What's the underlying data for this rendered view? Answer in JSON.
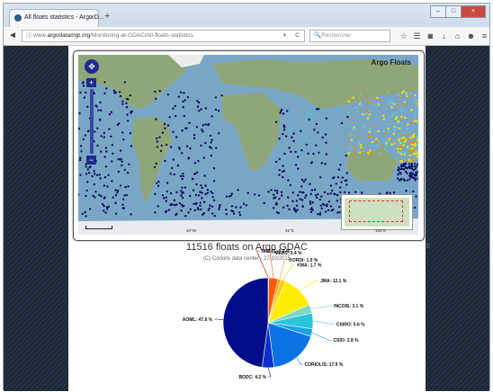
{
  "browser": {
    "tab_title": "All floats statistics - Argo D...",
    "tab_close": "×",
    "new_tab": "+",
    "window_minimize": "–",
    "window_maximize": "□",
    "window_close": "×",
    "back": "◄",
    "lock": "ⓘ",
    "url_prefix": "www.",
    "url_host": "argodatamgt.org",
    "url_path": "/Monitoring-at-GDAC/All-floats-statistics",
    "url_dropdown": "▾",
    "reload": "C",
    "search_placeholder": "Rechercher",
    "search_icon": "🔍",
    "toolbar": {
      "bookmark": "☆",
      "reading_list": "☰",
      "pocket": "◙",
      "download": "↓",
      "home": "⌂",
      "chat": "☻",
      "menu": "≡"
    }
  },
  "map": {
    "title": "Argo Floats",
    "pan": "✥",
    "zoom_in": "+",
    "zoom_out": "−",
    "lon_labels": [
      "60°W",
      "45°E",
      "150°E"
    ]
  },
  "chart": {
    "title": "11516 floats on Argo GDAC",
    "subtitle": "(C) Coriolis data center - 27/10/2015",
    "menu": "≡"
  },
  "chart_data": {
    "type": "pie",
    "title": "11516 floats on Argo GDAC",
    "subtitle": "(C) Coriolis data center - 27/10/2015",
    "slices": [
      {
        "label": "AOML",
        "value": 47.8,
        "color": "#000c8c"
      },
      {
        "label": "BODC",
        "value": 4.2,
        "color": "#0a2ec7"
      },
      {
        "label": "CORIOLIS",
        "value": 17.9,
        "color": "#0d72e6"
      },
      {
        "label": "CSIO",
        "value": 2.8,
        "color": "#19a4e8"
      },
      {
        "label": "CSIRO",
        "value": 5.6,
        "color": "#2dc5da"
      },
      {
        "label": "INCOIS",
        "value": 3.1,
        "color": "#7dd8c6"
      },
      {
        "label": "JMA",
        "value": 12.1,
        "color": "#ffee00"
      },
      {
        "label": "KMA",
        "value": 1.7,
        "color": "#ffc800"
      },
      {
        "label": "KORDI",
        "value": 1.0,
        "color": "#ff9a00"
      },
      {
        "label": "MEDS",
        "value": 3.4,
        "color": "#ff5a00"
      },
      {
        "label": "NMDIS",
        "value": 0.2,
        "color": "#e00000"
      }
    ],
    "labels_text": [
      "AOML: 47.8 %",
      "BODC: 4.2 %",
      "CORIOLIS: 17.9 %",
      "CSIO: 2.8 %",
      "CSIRO: 5.6 %",
      "INCOIS: 3.1 %",
      "JMA: 12.1 %",
      "KMA: 1.7 %",
      "KORDI: 1.0 %",
      "MEDS: 3.4 %",
      "NMDIS: 0.2 %"
    ]
  }
}
